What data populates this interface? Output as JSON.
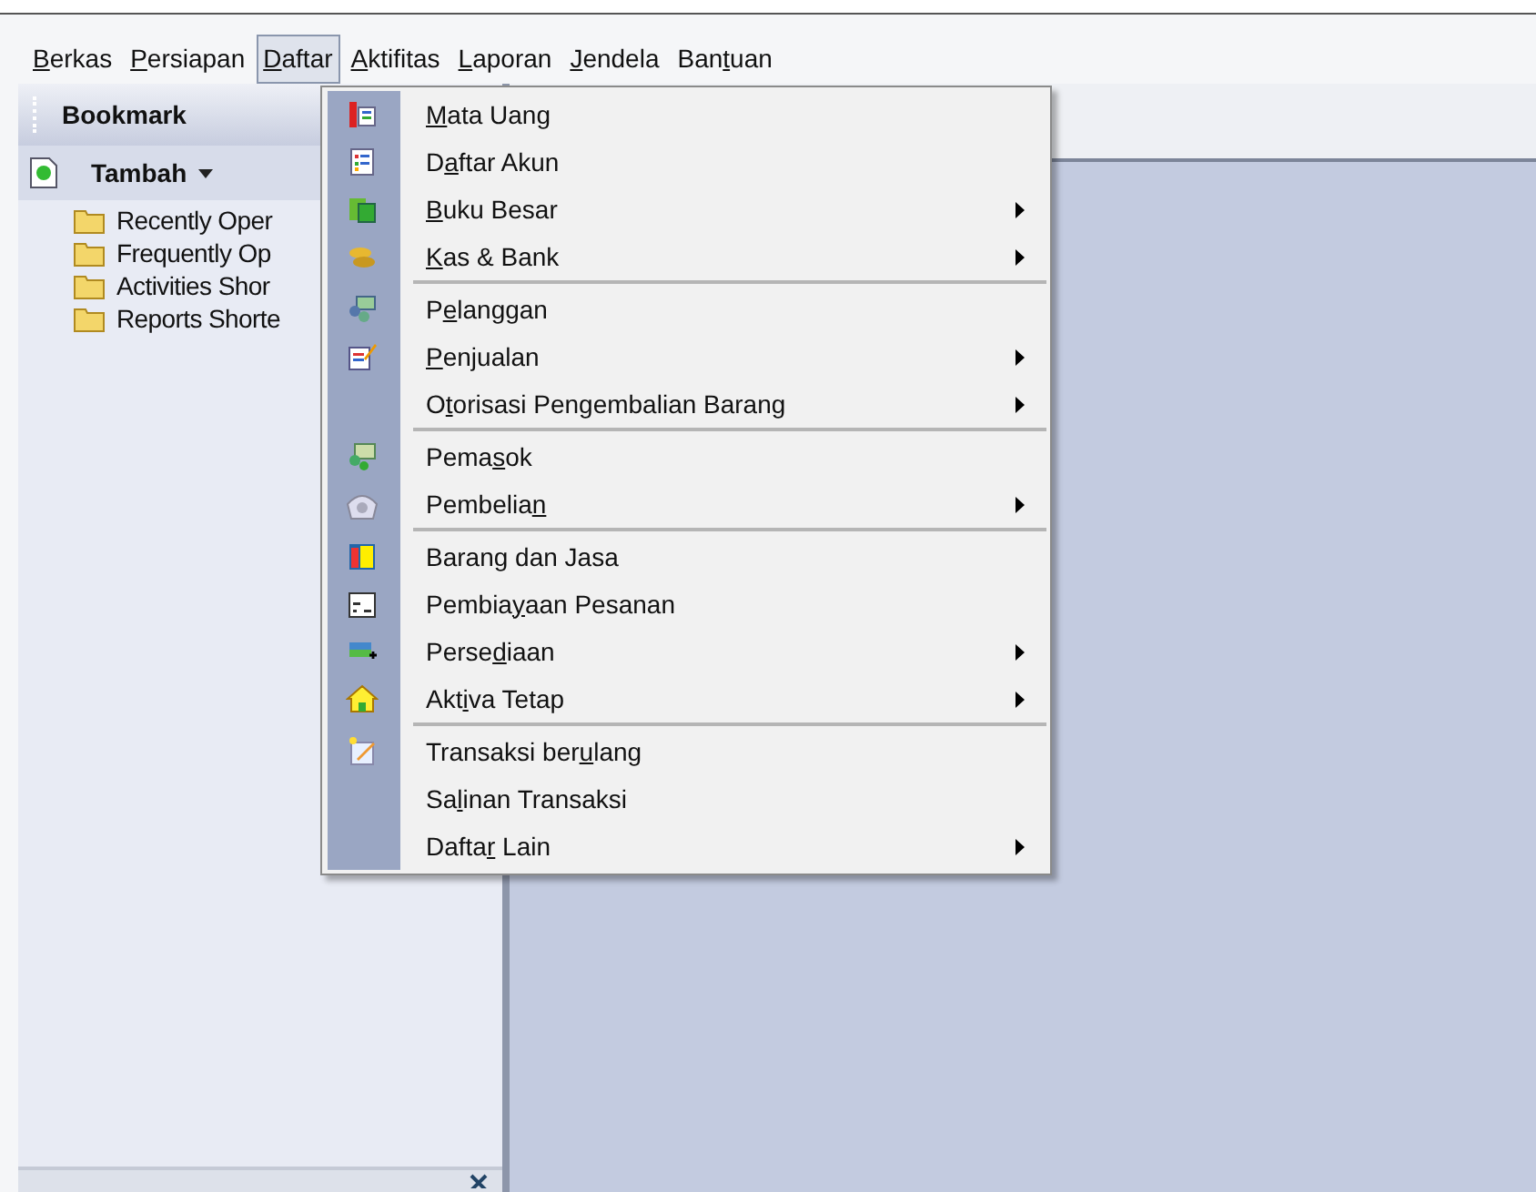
{
  "menubar": [
    {
      "label": {
        "key": "B",
        "after": "erkas"
      },
      "selected": false
    },
    {
      "label": {
        "key": "P",
        "after": "ersiapan"
      },
      "selected": false
    },
    {
      "label": {
        "key": "D",
        "after": "aftar"
      },
      "selected": true
    },
    {
      "label": {
        "key": "A",
        "after": "ktifitas"
      },
      "selected": false
    },
    {
      "label": {
        "key": "L",
        "after": "aporan"
      },
      "selected": false
    },
    {
      "label": {
        "key": "J",
        "after": "endela"
      },
      "selected": false
    },
    {
      "label": {
        "before": "Ban",
        "key": "t",
        "after": "uan"
      },
      "selected": false
    }
  ],
  "sidebar": {
    "title": "Bookmark",
    "add_button": "Tambah",
    "items": [
      "Recently Oper",
      "Frequently Op",
      "Activities Shor",
      "Reports Shorte"
    ]
  },
  "menu": {
    "groups": [
      [
        {
          "label": {
            "key": "M",
            "after": "ata Uang"
          },
          "has_icon": true,
          "submenu": false
        },
        {
          "label": {
            "before": "D",
            "key": "a",
            "after": "ftar Akun"
          },
          "has_icon": true,
          "submenu": false
        },
        {
          "label": {
            "key": "B",
            "after": "uku Besar"
          },
          "has_icon": true,
          "submenu": true
        },
        {
          "label": {
            "key": "K",
            "after": "as & Bank"
          },
          "has_icon": true,
          "submenu": true
        }
      ],
      [
        {
          "label": {
            "before": "P",
            "key": "e",
            "after": "langgan"
          },
          "has_icon": true,
          "submenu": false
        },
        {
          "label": {
            "key": "P",
            "after": "enjualan"
          },
          "has_icon": true,
          "submenu": true
        },
        {
          "label": {
            "before": "O",
            "key": "t",
            "after": "orisasi Pengembalian Barang"
          },
          "has_icon": false,
          "submenu": true
        }
      ],
      [
        {
          "label": {
            "before": "Pema",
            "key": "s",
            "after": "ok"
          },
          "has_icon": true,
          "submenu": false
        },
        {
          "label": {
            "before": "Pembelia",
            "key": "n"
          },
          "has_icon": true,
          "submenu": true
        }
      ],
      [
        {
          "label": {
            "before": "Baran",
            "key": "g",
            "after": " dan Jasa"
          },
          "has_icon": true,
          "submenu": false
        },
        {
          "label": {
            "before": "Pembia",
            "key": "y",
            "after": "aan Pesanan"
          },
          "has_icon": true,
          "submenu": false
        },
        {
          "label": {
            "before": "Perse",
            "key": "d",
            "after": "iaan"
          },
          "has_icon": true,
          "submenu": true
        },
        {
          "label": {
            "before": "Akt",
            "key": "i",
            "after": "va Tetap"
          },
          "has_icon": true,
          "submenu": true
        }
      ],
      [
        {
          "label": {
            "before": "Transaksi ber",
            "key": "u",
            "after": "lang"
          },
          "has_icon": true,
          "submenu": false
        },
        {
          "label": {
            "before": "Sa",
            "key": "l",
            "after": "inan Transaksi"
          },
          "has_icon": false,
          "submenu": false
        },
        {
          "label": {
            "before": "Dafta",
            "key": "r",
            "after": " Lain"
          },
          "has_icon": false,
          "submenu": true
        }
      ]
    ]
  }
}
